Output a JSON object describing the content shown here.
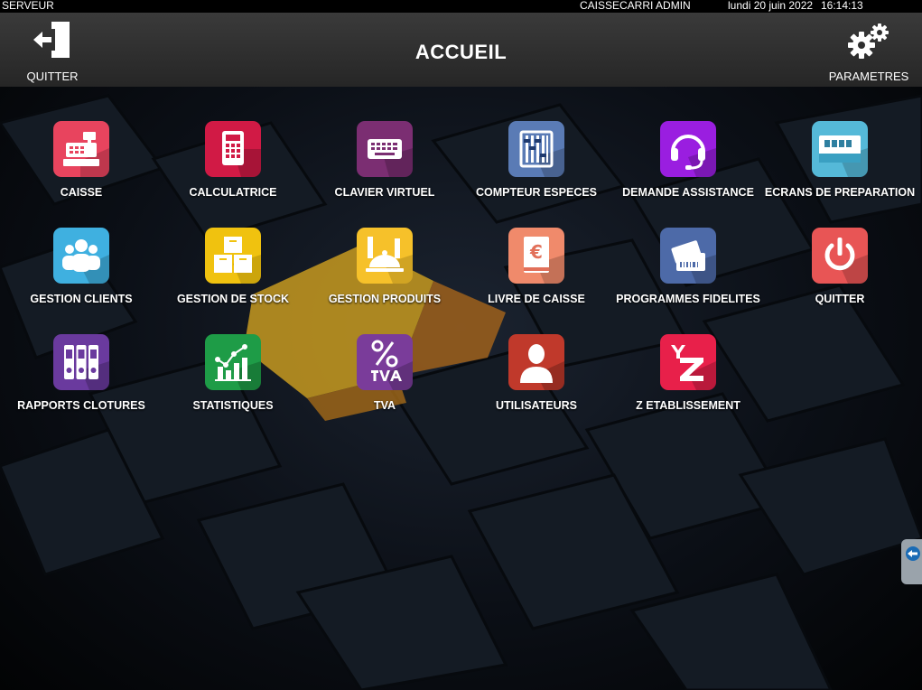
{
  "statusbar": {
    "server": "SERVEUR",
    "user": "CAISSECARRI ADMIN",
    "date": "lundi 20 juin 2022",
    "time": "16:14:13"
  },
  "header": {
    "title": "ACCUEIL",
    "quit_label": "QUITTER",
    "settings_label": "PARAMETRES"
  },
  "tiles": [
    {
      "label": "CAISSE",
      "icon": "cash-register-icon",
      "color": "#e8445e"
    },
    {
      "label": "CALCULATRICE",
      "icon": "calculator-icon",
      "color": "#d11a45"
    },
    {
      "label": "CLAVIER VIRTUEL",
      "icon": "keyboard-icon",
      "color": "#7b2e72"
    },
    {
      "label": "COMPTEUR ESPECES",
      "icon": "abacus-icon",
      "color": "#5a7bb5"
    },
    {
      "label": "DEMANDE ASSISTANCE",
      "icon": "headset-icon",
      "color": "#9a1ee0"
    },
    {
      "label": "ECRANS DE PREPARATION",
      "icon": "preparation-screen-icon",
      "color": "#55b9d8"
    },
    {
      "label": "GESTION CLIENTS",
      "icon": "customers-icon",
      "color": "#3fb0e0"
    },
    {
      "label": "GESTION DE STOCK",
      "icon": "stock-boxes-icon",
      "color": "#f0c20f"
    },
    {
      "label": "GESTION PRODUITS",
      "icon": "products-cloche-icon",
      "color": "#f6c12a"
    },
    {
      "label": "LIVRE DE CAISSE",
      "icon": "cash-book-icon",
      "color": "#f08a6b"
    },
    {
      "label": "PROGRAMMES FIDELITES",
      "icon": "loyalty-card-icon",
      "color": "#4d6aa8"
    },
    {
      "label": "QUITTER",
      "icon": "power-icon",
      "color": "#e85555"
    },
    {
      "label": "RAPPORTS CLOTURES",
      "icon": "binders-icon",
      "color": "#6a3a9e"
    },
    {
      "label": "STATISTIQUES",
      "icon": "statistics-icon",
      "color": "#1e9c47"
    },
    {
      "label": "TVA",
      "icon": "tva-percent-icon",
      "color": "#7a3c9a"
    },
    {
      "label": "UTILISATEURS",
      "icon": "user-icon",
      "color": "#c0392b"
    },
    {
      "label": "Z ETABLISSEMENT",
      "icon": "z-report-icon",
      "color": "#e8204a"
    }
  ]
}
